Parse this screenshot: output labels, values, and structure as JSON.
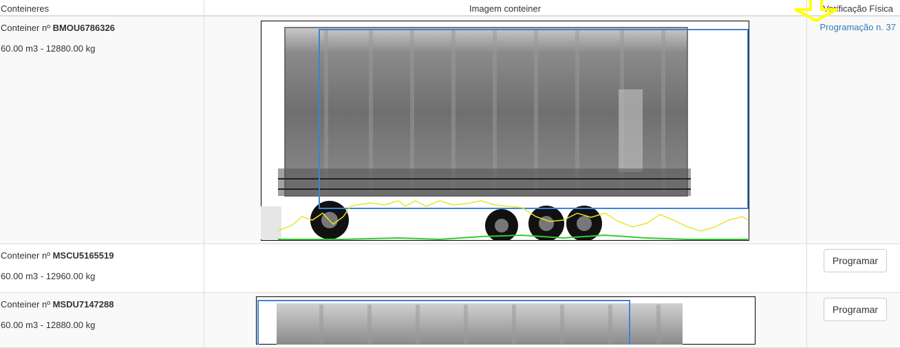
{
  "headers": {
    "containers": "Conteineres",
    "image": "Imagem conteiner",
    "physical_check": "Verificação Física"
  },
  "rows": [
    {
      "prefix": "Conteiner nº ",
      "id": "BMOU6786326",
      "specs": "60.00 m3 - 12880.00 kg",
      "action_type": "link",
      "action_label": "Programação n. 37"
    },
    {
      "prefix": "Conteiner nº ",
      "id": "MSCU5165519",
      "specs": "60.00 m3 - 12960.00 kg",
      "action_type": "button",
      "action_label": "Programar"
    },
    {
      "prefix": "Conteiner nº ",
      "id": "MSDU7147288",
      "specs": "60.00 m3 - 12880.00 kg",
      "action_type": "button",
      "action_label": "Programar"
    }
  ],
  "colors": {
    "link": "#337ab7",
    "border": "#dddddd",
    "stripe": "#f9f9f9",
    "annotation_arrow": "#ffff00",
    "scan_box": "#3b82d6",
    "trace_yellow": "#e6e62e",
    "trace_green": "#33cc33"
  },
  "icons": {
    "annotation": "arrow-down-icon"
  }
}
